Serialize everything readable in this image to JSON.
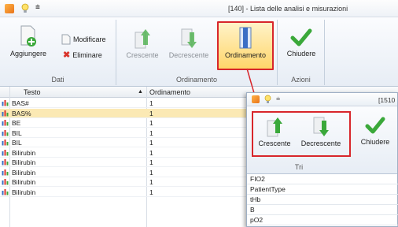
{
  "window": {
    "title": "[140] - Lista delle analisi e misurazioni"
  },
  "ribbon": {
    "dati": {
      "label": "Dati",
      "add_label": "Aggiungere",
      "edit_label": "Modificare",
      "delete_label": "Eliminare"
    },
    "ordinamento": {
      "label": "Ordinamento",
      "asc_label": "Crescente",
      "desc_label": "Decrescente",
      "sort_label": "Ordinamento"
    },
    "azioni": {
      "label": "Azioni",
      "close_label": "Chiudere"
    }
  },
  "grid": {
    "columns": [
      "Testo",
      "Ordinamento"
    ],
    "rows": [
      {
        "testo": "BAS#",
        "ordinamento": "1"
      },
      {
        "testo": "BAS%",
        "ordinamento": "1"
      },
      {
        "testo": "BE",
        "ordinamento": "1"
      },
      {
        "testo": "BIL",
        "ordinamento": "1"
      },
      {
        "testo": "BIL",
        "ordinamento": "1"
      },
      {
        "testo": "Bilirubin",
        "ordinamento": "1"
      },
      {
        "testo": "Bilirubin",
        "ordinamento": "1"
      },
      {
        "testo": "Bilirubin",
        "ordinamento": "1"
      },
      {
        "testo": "Bilirubin",
        "ordinamento": "1"
      },
      {
        "testo": "Bilirubin",
        "ordinamento": "1"
      }
    ]
  },
  "sub_window": {
    "title": "[1510",
    "tri_label": "Tri",
    "asc_label": "Crescente",
    "desc_label": "Decrescente",
    "close_label": "Chiudere",
    "rows": [
      "FIO2",
      "PatientType",
      "tHb",
      "B",
      "pO2"
    ]
  },
  "colors": {
    "highlight": "#d8262b",
    "selected_row": "#fbe9b4",
    "arrow_green": "#3aa83a"
  }
}
